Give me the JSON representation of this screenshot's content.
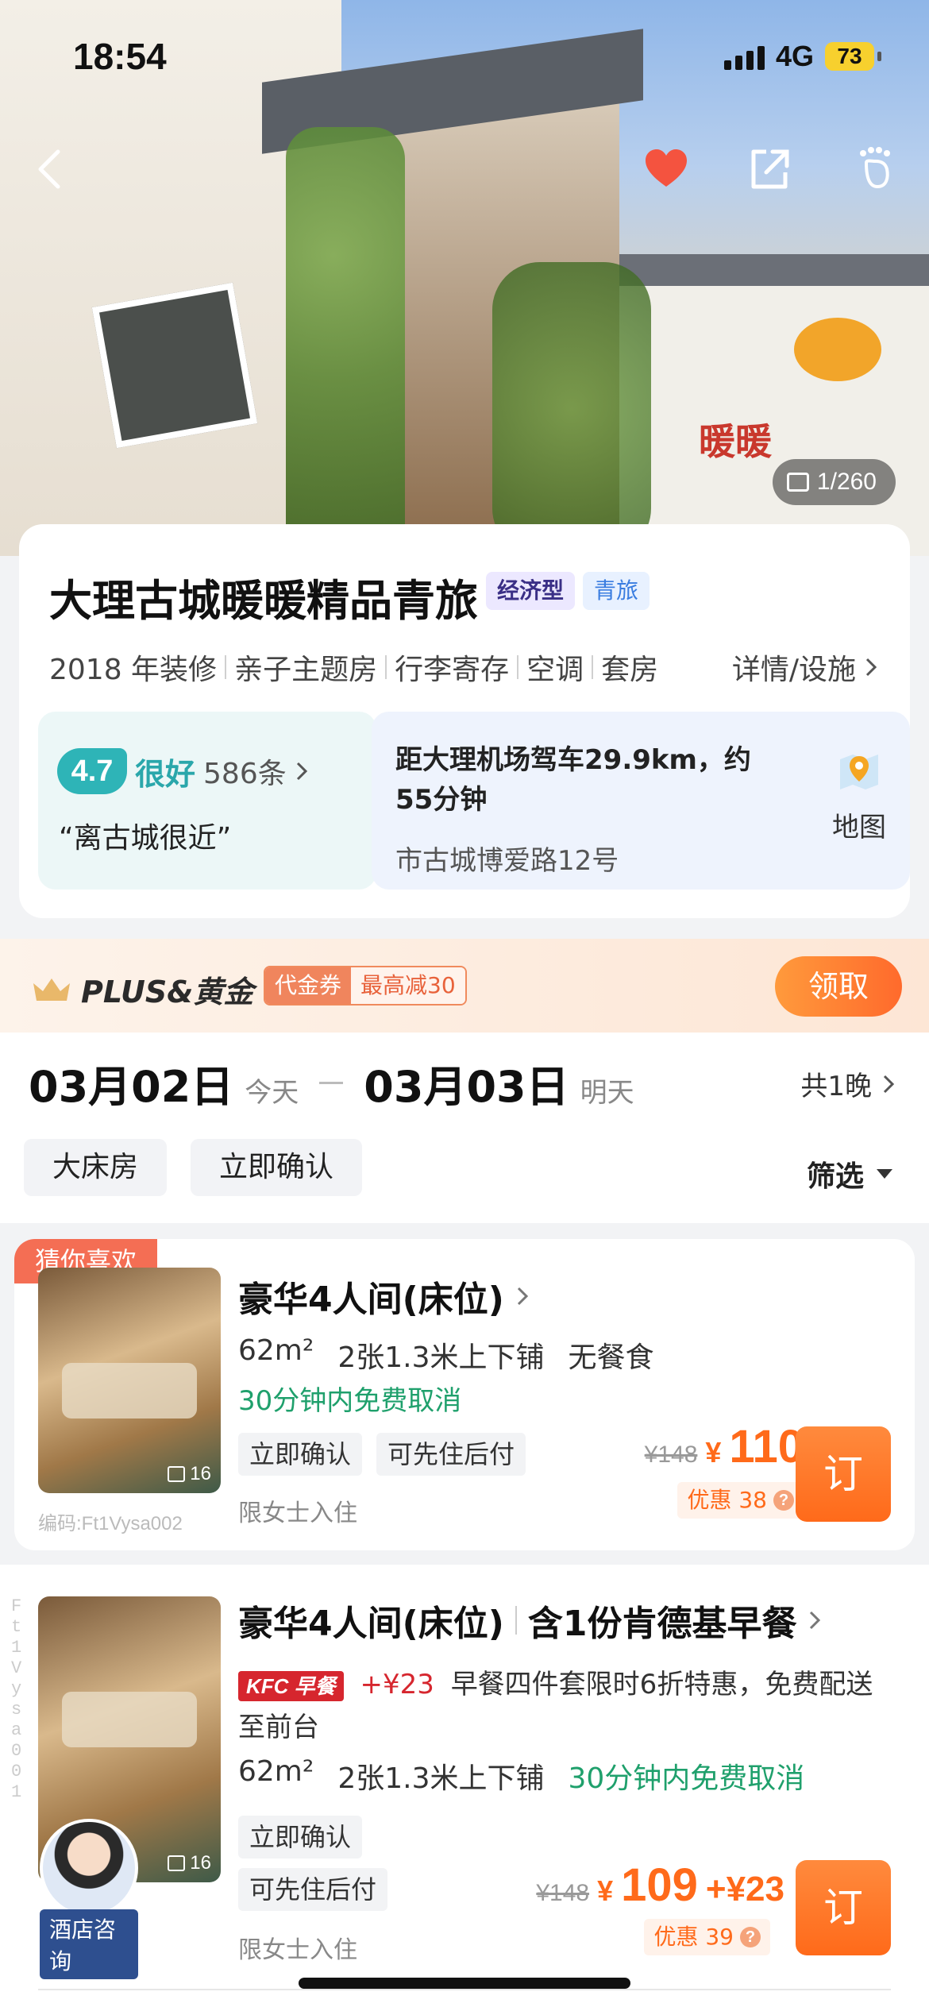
{
  "status_bar": {
    "time": "18:54",
    "network": "4G",
    "battery": "73"
  },
  "hero": {
    "photo_counter": "1/260",
    "sign_text": "暖暖"
  },
  "hotel": {
    "name": "大理古城暖暖精品青旅",
    "tags": [
      "经济型",
      "青旅"
    ],
    "features": [
      "2018 年装修",
      "亲子主题房",
      "行李寄存",
      "空调",
      "套房"
    ],
    "details_link": "详情/设施"
  },
  "rating": {
    "score": "4.7",
    "word": "很好",
    "count": "586条",
    "quote": "“离古城很近”"
  },
  "location": {
    "distance": "距大理机场驾车29.9km，约55分钟",
    "address": "市古城博爱路12号",
    "map_label": "地图"
  },
  "plus_banner": {
    "title": "PLUS&黄金",
    "coupon_label": "代金券",
    "coupon_value": "最高减30",
    "claim_label": "领取"
  },
  "dates": {
    "checkin": "03月02日",
    "checkin_hint": "今天",
    "checkout": "03月03日",
    "checkout_hint": "明天",
    "nights": "共1晚"
  },
  "filters": {
    "chips": [
      "大床房",
      "立即确认"
    ],
    "filter_label": "筛选"
  },
  "rooms": [
    {
      "badge": "猜你喜欢",
      "title": "豪华4人间(床位)",
      "area": "62m²",
      "beds": "2张1.3米上下铺",
      "meal": "无餐食",
      "cancel": "30分钟内免费取消",
      "pills": [
        "立即确认",
        "可先住后付"
      ],
      "limit": "限女士入住",
      "photo_count": "16",
      "code": "编码:Ft1Vysa002",
      "orig_price": "¥148",
      "currency": "¥",
      "price": "110",
      "discount": "优惠 38",
      "book": "订"
    },
    {
      "title": "豪华4人间(床位)",
      "subtitle": "含1份肯德基早餐",
      "kfc_label": "KFC 早餐",
      "addon_price": "+¥23",
      "breakfast_desc": "早餐四件套限时6折特惠，免费配送至前台",
      "area": "62m²",
      "beds": "2张1.3米上下铺",
      "cancel": "30分钟内免费取消",
      "pills": [
        "立即确认",
        "可先住后付"
      ],
      "limit": "限女士入住",
      "photo_count": "16",
      "side_code": "Ft1Vysa001",
      "orig_price": "¥148",
      "currency": "¥",
      "price": "109",
      "price_addon": "+¥23",
      "discount": "优惠 39",
      "book": "订",
      "consult_label": "酒店咨询"
    }
  ]
}
